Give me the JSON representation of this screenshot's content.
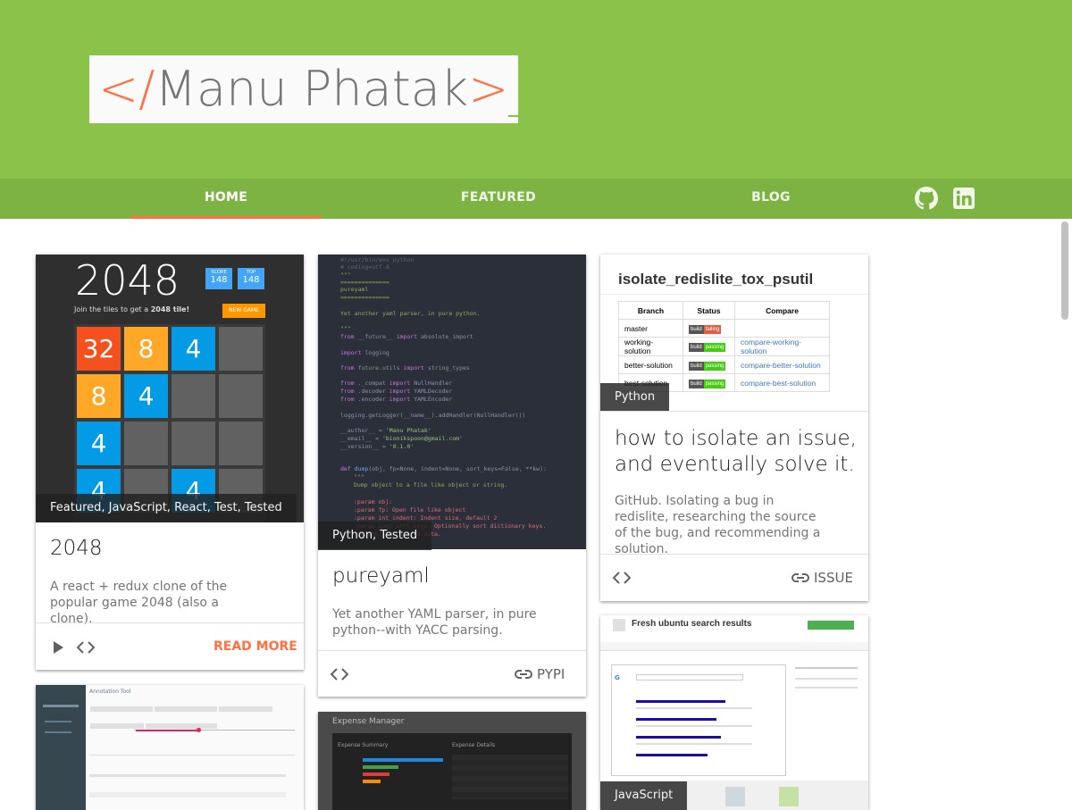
{
  "site": {
    "logo_prefix": "</",
    "logo_name": "Manu Phatak",
    "logo_suffix": ">",
    "logo_cursor": "_"
  },
  "nav": {
    "items": [
      {
        "label": "HOME",
        "active": true
      },
      {
        "label": "FEATURED",
        "active": false
      },
      {
        "label": "BLOG",
        "active": false
      }
    ],
    "icons": [
      "github-icon",
      "linkedin-icon"
    ]
  },
  "cards": {
    "c2048": {
      "tags": "Featured, JavaScript, React, Test, Tested",
      "title": "2048",
      "desc": "A react + redux clone of the popular game 2048 (also a clone).",
      "action": "READ MORE",
      "game": {
        "heading": "2048",
        "score_label": "SCORE",
        "score": "148",
        "top_label": "TOP",
        "top": "148",
        "subtitle_pre": "Join the tiles to get a ",
        "subtitle_bold": "2048 tile!",
        "new_game": "NEW GAME",
        "tiles": [
          "32",
          "8",
          "4",
          "",
          "8",
          "4",
          "",
          "",
          "4",
          "",
          "",
          "",
          "4",
          "",
          "4",
          ""
        ]
      }
    },
    "pureyaml": {
      "tags": "Python, Tested",
      "title": "pureyaml",
      "desc": "Yet another YAML parser, in pure python--with YACC parsing.",
      "action": "PYPI"
    },
    "isolate": {
      "tags": "Python",
      "thumb_title": "isolate_redislite_tox_psutil",
      "table_headers": [
        "Branch",
        "Status",
        "Compare"
      ],
      "rows": [
        {
          "branch": "master",
          "status": "failing",
          "compare": ""
        },
        {
          "branch": "working-solution",
          "status": "passing",
          "compare": "compare-working-solution"
        },
        {
          "branch": "better-solution",
          "status": "passing",
          "compare": "compare-better-solution"
        },
        {
          "branch": "best-solution",
          "status": "passing",
          "compare": "compare-best-solution"
        }
      ],
      "badge_label": "build",
      "title_line1": "how to isolate an issue,",
      "title_line2": "and eventually solve it.",
      "desc": "GitHub.  Isolating a bug in redislite, researching the source of the bug, and recommending a solution.",
      "action": "ISSUE"
    },
    "ubuntu": {
      "tags": "JavaScript",
      "ext_title": "Fresh ubuntu search results"
    },
    "expense": {
      "title": "Expense Manager",
      "summary": "Expense Summary",
      "details": "Expense Details"
    },
    "annotation": {
      "title": "Annotation Tool"
    }
  },
  "colors": {
    "header": "#8bc34a",
    "nav": "#7cb342",
    "accent": "#ff7043"
  }
}
